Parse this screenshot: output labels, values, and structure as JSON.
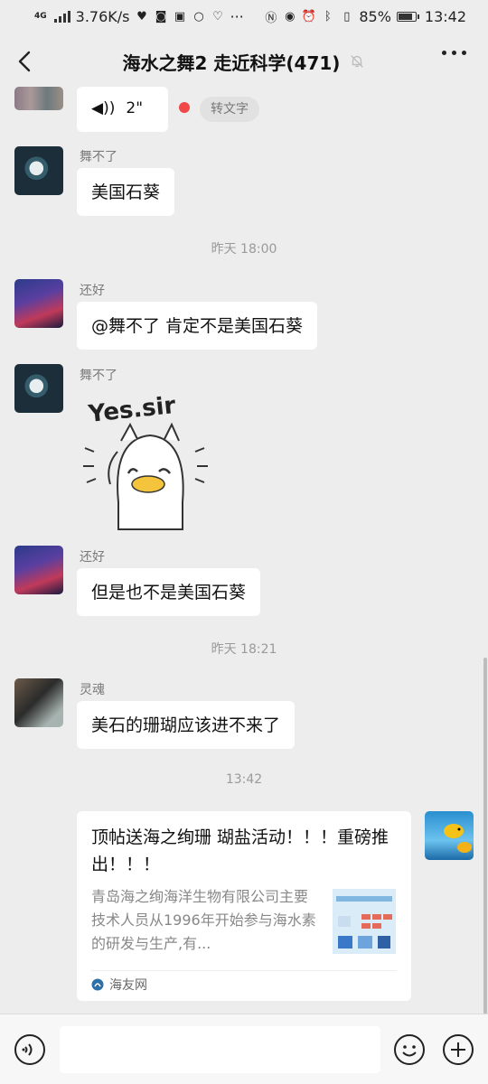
{
  "status_bar": {
    "network": "4G",
    "speed": "3.76K/s",
    "battery": "85%",
    "battery_level": 0.85,
    "time": "13:42"
  },
  "header": {
    "title": "海水之舞2 走近科学(471)",
    "back_icon": "chevron-left-icon",
    "mute_icon": "bell-off-icon",
    "more_icon": "more-dots-icon"
  },
  "messages": {
    "voice": {
      "duration": "2\"",
      "to_text": "转文字"
    },
    "m1": {
      "sender": "舞不了",
      "text": "美国石葵"
    },
    "t1": "昨天 18:00",
    "m2": {
      "sender": "还好",
      "text": "@舞不了  肯定不是美国石葵"
    },
    "m3": {
      "sender": "舞不了",
      "sticker_text": "Yes.sir"
    },
    "m4": {
      "sender": "还好",
      "text": "但是也不是美国石葵"
    },
    "t2": "昨天 18:21",
    "m5": {
      "sender": "灵魂",
      "text": "美石的珊瑚应该进不来了"
    },
    "t3": "13:42",
    "card": {
      "title": "顶帖送海之绚珊 瑚盐活动！！！重磅推出！！！",
      "description": "青岛海之绚海洋生物有限公司主要技术人员从1996年开始参与海水素的研发与生产,有...",
      "source": "海友网"
    }
  },
  "input_bar": {
    "voice_icon": "voice-icon",
    "emoji_icon": "emoji-icon",
    "plus_icon": "plus-icon",
    "placeholder": ""
  }
}
